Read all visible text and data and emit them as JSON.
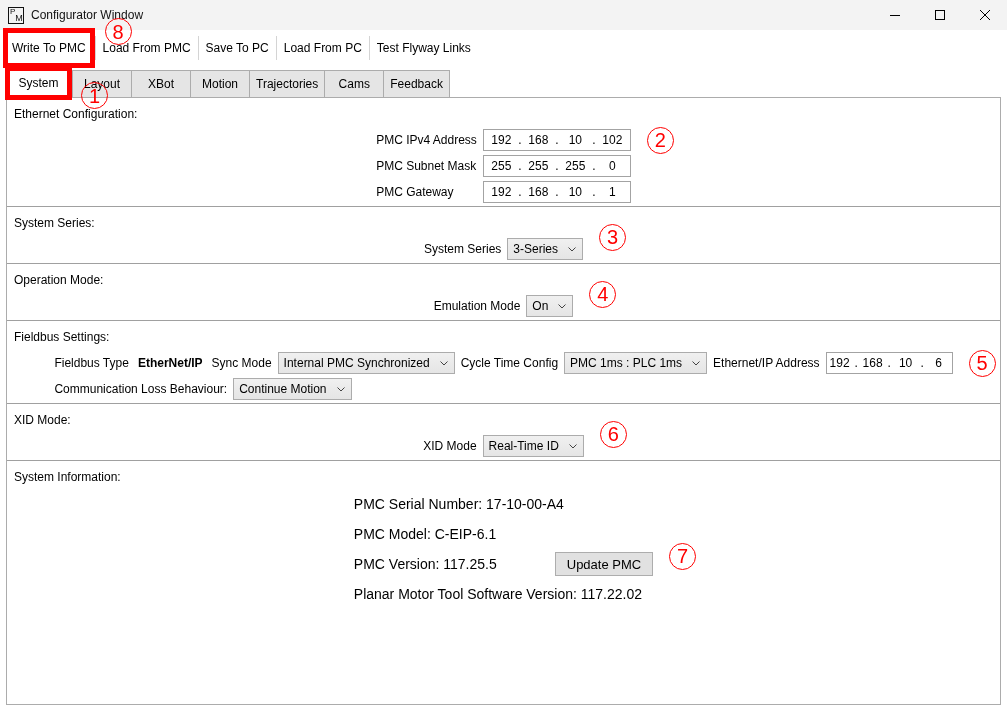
{
  "window": {
    "title": "Configurator Window",
    "logo": {
      "upper": "P",
      "lower": "M"
    }
  },
  "toolbar": [
    {
      "label": "Write To PMC",
      "highlighted": true,
      "callout": "8"
    },
    {
      "label": "Load From PMC",
      "highlighted": false
    },
    {
      "label": "Save To PC",
      "highlighted": false
    },
    {
      "label": "Load From PC",
      "highlighted": false
    },
    {
      "label": "Test Flyway Links",
      "highlighted": false
    }
  ],
  "tabs": [
    {
      "label": "System",
      "selected": true,
      "highlighted": true,
      "callout": "1"
    },
    {
      "label": "Layout",
      "selected": false,
      "highlighted": false
    },
    {
      "label": "XBot",
      "selected": false,
      "highlighted": false
    },
    {
      "label": "Motion",
      "selected": false,
      "highlighted": false
    },
    {
      "label": "Trajectories",
      "selected": false,
      "highlighted": false
    },
    {
      "label": "Cams",
      "selected": false,
      "highlighted": false
    },
    {
      "label": "Feedback",
      "selected": false,
      "highlighted": false
    }
  ],
  "sections": [
    {
      "kind": "grid",
      "heading": "Ethernet Configuration:",
      "fields": [
        {
          "label": "PMC IPv4 Address",
          "control": {
            "kind": "ip",
            "value": "192 . 168 . 10 . 102"
          },
          "callout": "2"
        },
        {
          "label": "PMC Subnet Mask",
          "control": {
            "kind": "ip",
            "value": "255 . 255 . 255 . 0"
          }
        },
        {
          "label": "PMC Gateway",
          "control": {
            "kind": "ip",
            "value": "192 . 168 . 10 . 1"
          }
        }
      ]
    },
    {
      "kind": "form",
      "heading": "System Series:",
      "lines": [
        {
          "fields": [
            {
              "label": "System Series",
              "control": {
                "kind": "select",
                "value": "3-Series"
              },
              "callout": "3"
            }
          ]
        }
      ]
    },
    {
      "kind": "form",
      "heading": "Operation Mode:",
      "lines": [
        {
          "fields": [
            {
              "label": "Emulation Mode",
              "control": {
                "kind": "select",
                "value": "On"
              },
              "callout": "4"
            }
          ]
        }
      ]
    },
    {
      "kind": "form",
      "heading": "Fieldbus Settings:",
      "lines": [
        {
          "fields": [
            {
              "label": "Fieldbus Type",
              "control": {
                "kind": "value",
                "text": "EtherNet/IP"
              }
            },
            {
              "label": "Sync Mode",
              "control": {
                "kind": "select",
                "value": "Internal PMC Synchronized"
              }
            },
            {
              "label": "Cycle Time Config",
              "control": {
                "kind": "select",
                "value": "PMC 1ms : PLC 1ms"
              }
            },
            {
              "label": "Ethernet/IP Address",
              "control": {
                "kind": "ip",
                "value": "192 . 168 . 10 . 6"
              },
              "callout": "5"
            }
          ]
        },
        {
          "fields": [
            {
              "label": "Communication Loss Behaviour:",
              "control": {
                "kind": "select",
                "value": "Continue Motion"
              }
            }
          ]
        }
      ]
    },
    {
      "kind": "form",
      "heading": "XID Mode:",
      "lines": [
        {
          "fields": [
            {
              "label": "XID Mode",
              "control": {
                "kind": "select",
                "value": "Real-Time ID"
              },
              "callout": "6"
            }
          ]
        }
      ]
    },
    {
      "kind": "info",
      "heading": "System Information:",
      "lines": [
        {
          "text": "PMC Serial Number: 17-10-00-A4"
        },
        {
          "text": "PMC Model: C-EIP-6.1"
        },
        {
          "text": "PMC Version: 117.25.5",
          "button": {
            "label": "Update PMC",
            "callout": "7"
          }
        },
        {
          "text": "Planar Motor Tool Software Version: 117.22.02"
        }
      ]
    }
  ]
}
